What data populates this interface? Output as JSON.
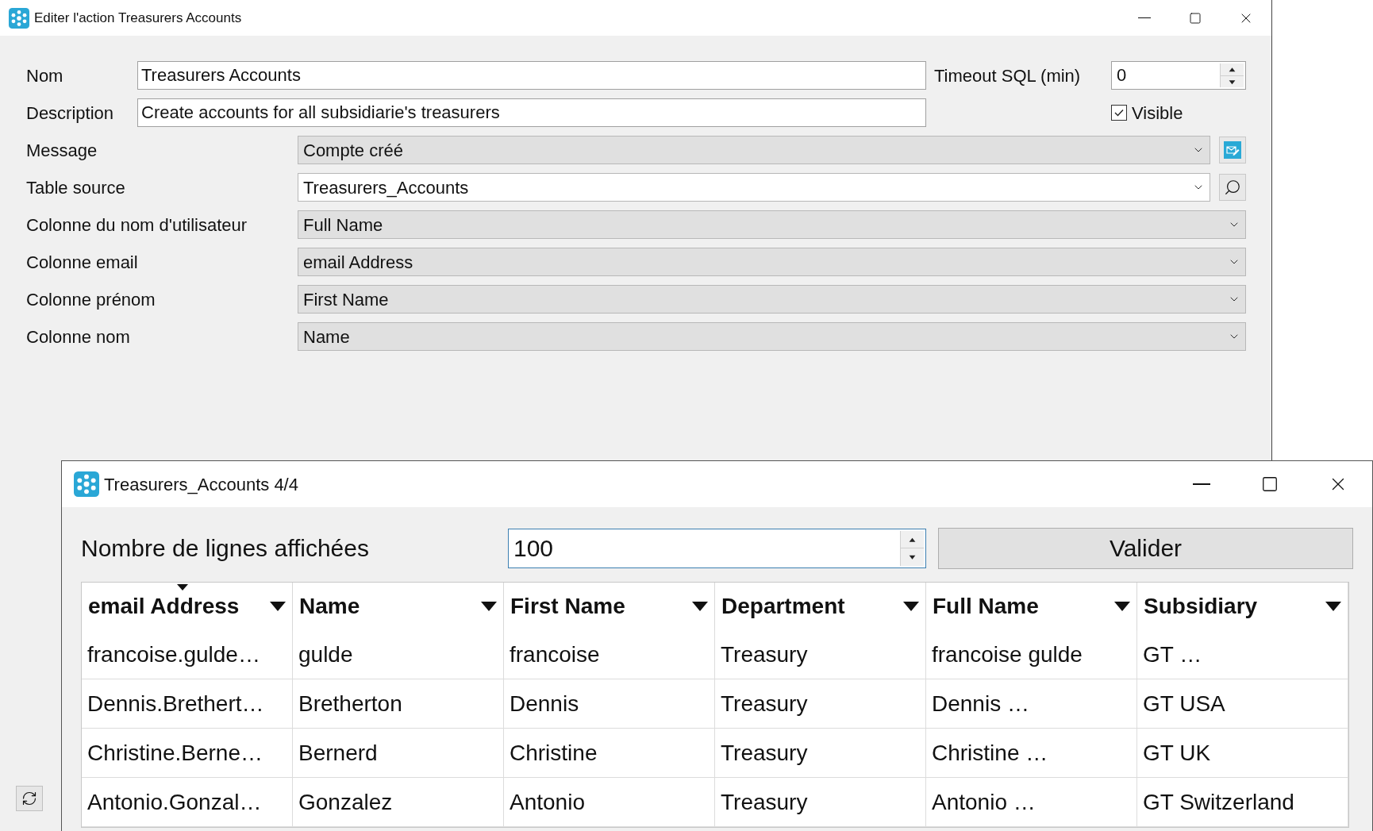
{
  "main_window": {
    "title": "Editer l'action Treasurers Accounts",
    "name": {
      "label": "Nom",
      "value": "Treasurers Accounts"
    },
    "timeout": {
      "label": "Timeout SQL (min)",
      "value": "0"
    },
    "description": {
      "label": "Description",
      "value": "Create accounts for all subsidiarie's treasurers"
    },
    "visible": {
      "label": "Visible",
      "checked": true
    },
    "combos": [
      {
        "label": "Message",
        "value": "Compte créé",
        "editable": false,
        "button": {
          "kind": "edit"
        }
      },
      {
        "label": "Table source",
        "value": "Treasurers_Accounts",
        "editable": true,
        "button": {
          "kind": "search"
        }
      },
      {
        "label": "Colonne du nom d'utilisateur",
        "value": "Full Name",
        "editable": false
      },
      {
        "label": "Colonne email",
        "value": "email Address",
        "editable": false
      },
      {
        "label": "Colonne prénom",
        "value": "First Name",
        "editable": false
      },
      {
        "label": "Colonne nom",
        "value": "Name",
        "editable": false
      }
    ]
  },
  "table_window": {
    "title": "Treasurers_Accounts 4/4",
    "rows_field": {
      "label": "Nombre de lignes affichées",
      "value": "100",
      "focused": true
    },
    "button": "Valider",
    "table": {
      "columns": [
        {
          "label": "email Address",
          "sorted": true
        },
        {
          "label": "Name",
          "sorted": false
        },
        {
          "label": "First Name",
          "sorted": false
        },
        {
          "label": "Department",
          "sorted": false
        },
        {
          "label": "Full Name",
          "sorted": false
        },
        {
          "label": "Subsidiary",
          "sorted": false
        }
      ],
      "rows": [
        [
          "francoise.gulde…",
          "gulde",
          "francoise",
          "Treasury",
          "francoise gulde",
          "GT …"
        ],
        [
          "Dennis.Brethert…",
          "Bretherton",
          "Dennis",
          "Treasury",
          "Dennis …",
          "GT USA"
        ],
        [
          "Christine.Berne…",
          "Bernerd",
          "Christine",
          "Treasury",
          "Christine …",
          "GT UK"
        ],
        [
          "Antonio.Gonzal…",
          "Gonzalez",
          "Antonio",
          "Treasury",
          "Antonio …",
          "GT Switzerland"
        ]
      ]
    }
  }
}
